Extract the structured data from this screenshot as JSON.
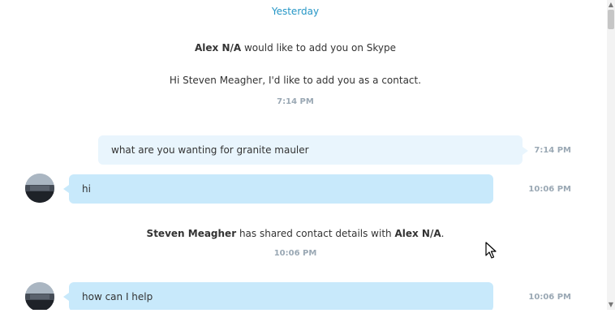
{
  "chat": {
    "date_separator": "Yesterday",
    "contact_request": {
      "sender": "Alex N/A",
      "title_suffix": " would like to add you on Skype",
      "message": "Hi Steven Meagher, I'd like to add you as a contact.",
      "time": "7:14 PM"
    },
    "messages": [
      {
        "direction": "out",
        "text": "what are you wanting for granite mauler",
        "time": "7:14 PM"
      },
      {
        "direction": "in",
        "text": "hi",
        "time": "10:06 PM"
      },
      {
        "direction": "in",
        "text": "how can I help",
        "time": "10:06 PM"
      }
    ],
    "share_notice": {
      "sharer": "Steven Meagher",
      "middle": " has shared contact details with ",
      "recipient": "Alex N/A",
      "end": ".",
      "time": "10:06 PM"
    }
  },
  "icons": {
    "scroll_up": "scroll-up-arrow-icon",
    "scroll_down": "scroll-down-arrow-icon",
    "cursor": "mouse-pointer-icon"
  },
  "colors": {
    "date_link": "#2596c6",
    "incoming_bubble": "#c8e9fb",
    "outgoing_bubble": "#e9f5fd",
    "timestamp": "#9aa8b4"
  }
}
